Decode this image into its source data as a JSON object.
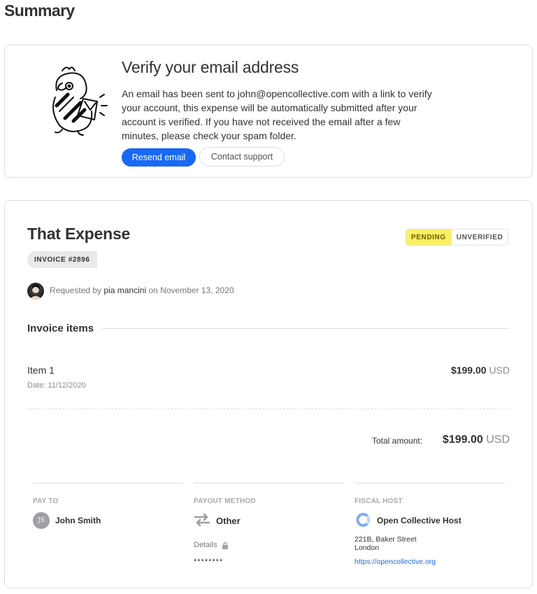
{
  "page": {
    "title": "Summary"
  },
  "verify": {
    "title": "Verify your email address",
    "message": "An email has been sent to john@opencollective.com with a link to verify your account, this expense will be automatically submitted after your account is verified. If you have not received the email after a few minutes, please check your spam folder.",
    "resend_label": "Resend email",
    "support_label": "Contact support"
  },
  "expense": {
    "title": "That Expense",
    "invoice_badge": "INVOICE #2896",
    "status": "PENDING",
    "verification": "UNVERIFIED",
    "requested_prefix": "Requested by",
    "requester": "pia mancini",
    "on_word": "on",
    "date": "November 13, 2020"
  },
  "invoice_items": {
    "title": "Invoice items",
    "items": [
      {
        "description": "Item 1",
        "date": "Date: 11/12/2020",
        "amount": "$199.00",
        "currency": "USD"
      }
    ],
    "total_label": "Total amount:",
    "total_amount": "$199.00",
    "total_currency": "USD"
  },
  "pay_to": {
    "label": "PAY TO",
    "initials": "JS",
    "name": "John Smith"
  },
  "payout_method": {
    "label": "PAYOUT METHOD",
    "type": "Other",
    "details_label": "Details",
    "details_value": "********",
    "icon": "exchange-arrows-icon"
  },
  "fiscal_host": {
    "label": "FISCAL HOST",
    "name": "Open Collective Host",
    "address_line1": "221B, Baker Street",
    "address_line2": "London",
    "url": "https://opencollective.org"
  },
  "colors": {
    "primary": "#1869f5",
    "pending": "#fbef63",
    "text": "#313233",
    "muted": "#76777a"
  }
}
